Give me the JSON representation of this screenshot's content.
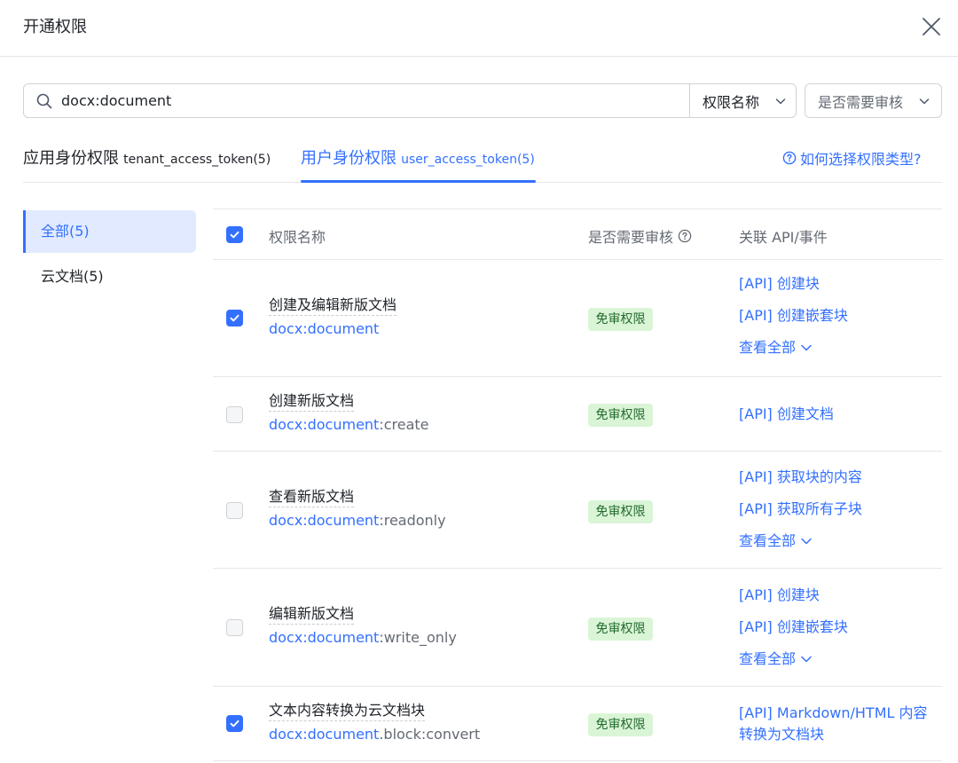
{
  "dialog": {
    "title": "开通权限"
  },
  "search": {
    "value": "docx:document",
    "placeholder": ""
  },
  "filters": {
    "name_label": "权限名称",
    "review_label": "是否需要审核"
  },
  "tabs": {
    "tenant": {
      "label": "应用身份权限",
      "token": "tenant_access_token(5)"
    },
    "user": {
      "label": "用户身份权限",
      "token": "user_access_token(5)"
    },
    "help": "如何选择权限类型?"
  },
  "sidebar": {
    "items": [
      {
        "label": "全部(5)"
      },
      {
        "label": "云文档(5)"
      }
    ]
  },
  "table": {
    "headers": {
      "name": "权限名称",
      "review": "是否需要审核",
      "api": "关联 API/事件"
    },
    "rows": [
      {
        "title": "创建及编辑新版文档",
        "code_prefix": "docx:document",
        "code_suffix": "",
        "badge": "免审权限",
        "apis": [
          "[API] 创建块",
          "[API] 创建嵌套块"
        ],
        "view_all": "查看全部",
        "checked": true
      },
      {
        "title": "创建新版文档",
        "code_prefix": "docx:document",
        "code_suffix": ":create",
        "badge": "免审权限",
        "apis": [
          "[API] 创建文档"
        ],
        "view_all": "",
        "checked": false
      },
      {
        "title": "查看新版文档",
        "code_prefix": "docx:document",
        "code_suffix": ":readonly",
        "badge": "免审权限",
        "apis": [
          "[API] 获取块的内容",
          "[API] 获取所有子块"
        ],
        "view_all": "查看全部",
        "checked": false
      },
      {
        "title": "编辑新版文档",
        "code_prefix": "docx:document",
        "code_suffix": ":write_only",
        "badge": "免审权限",
        "apis": [
          "[API] 创建块",
          "[API] 创建嵌套块"
        ],
        "view_all": "查看全部",
        "checked": false
      },
      {
        "title": "文本内容转换为云文档块",
        "code_prefix": "docx:document",
        "code_suffix": ".block:convert",
        "badge": "免审权限",
        "apis": [
          "[API] Markdown/HTML 内容转换为文档块"
        ],
        "view_all": "",
        "checked": true
      }
    ]
  },
  "colors": {
    "accent": "#3370ff",
    "badge_bg": "#d9f5d6",
    "badge_text": "#24692e",
    "divider": "#e5e6eb"
  }
}
